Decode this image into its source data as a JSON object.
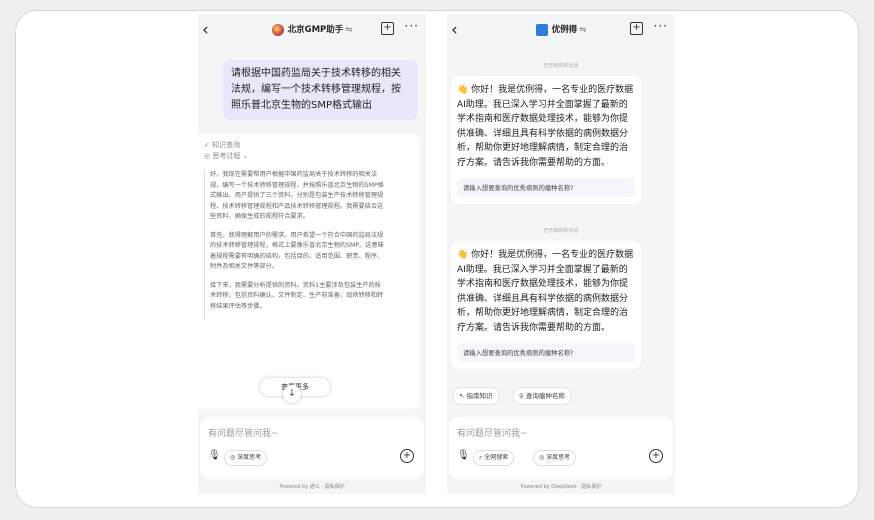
{
  "left": {
    "title": "北京GMP助手",
    "swap": "⇋",
    "user_message": "请根据中国药监局关于技术转移的相关法规，编写一个技术转移管理规程，按照乐普北京生物的SMP格式输出",
    "knowledge_label": "✓ 知识查询",
    "thinking_label": "◎ 思考过程 ⌄",
    "thinking": [
      "好，我现在需要帮用户根据中国药监局关于技术转移的相关法规，编写一个技术转移管理规程，并按照乐普北京生物的SMP格式输出。用户提供了三个资料，分别是包装生产技术转移管理规程、技术转移管理规程和产品技术转移管理规程。我需要结合这些资料，确保生成的规程符合要求。",
      "首先，我得理解用户的需求。用户希望一个符合中国药监局法规的技术转移管理规程，格式上要像乐普北京生物的SMP。这意味着规程需要有明确的结构，包括目的、适用范围、职责、程序、附件及相关文件等部分。",
      "接下来，我需要分析提供的资料。资料1主要涉及包装生产的技术转移，包括资料确认、文件制定、生产前准备、现场转移和转移结果评估等步骤。"
    ],
    "more_label": "查看更多",
    "input_placeholder": "有问题尽管问我~",
    "deep_think": "◎ 深度思考",
    "powered": "Powered by 通义  ·  隐私保护"
  },
  "right": {
    "title": "优例得",
    "swap": "⇋",
    "sys_note_1": "已开启新的对话",
    "sys_note_2": "已开启新的对话",
    "welcome_text": "👋 你好！我是优例得，一名专业的医疗数据AI助理。我已深入学习并全面掌握了最新的学术指南和医疗数据处理技术，能够为你提供准确、详细且具有科学依据的病例数据分析，帮助你更好地理解病情，制定合理的治疗方案。请告诉我你需要帮助的方面。",
    "welcome_prompt": "请输入想要查询的优秀病例的瘤种名称?",
    "chip_guide": "↖ 指南知识",
    "chip_query": "⚲ 查询瘤种名称",
    "input_placeholder": "有问题尽管问我~",
    "web_search": "⌕ 全网搜索",
    "deep_think": "◎ 深度思考",
    "powered": "Powered by DeepSeek  ·  隐私保护"
  },
  "colors": {
    "user_bubble": "#e8e7fb",
    "background": "#f4f5f7",
    "card": "#ffffff"
  }
}
